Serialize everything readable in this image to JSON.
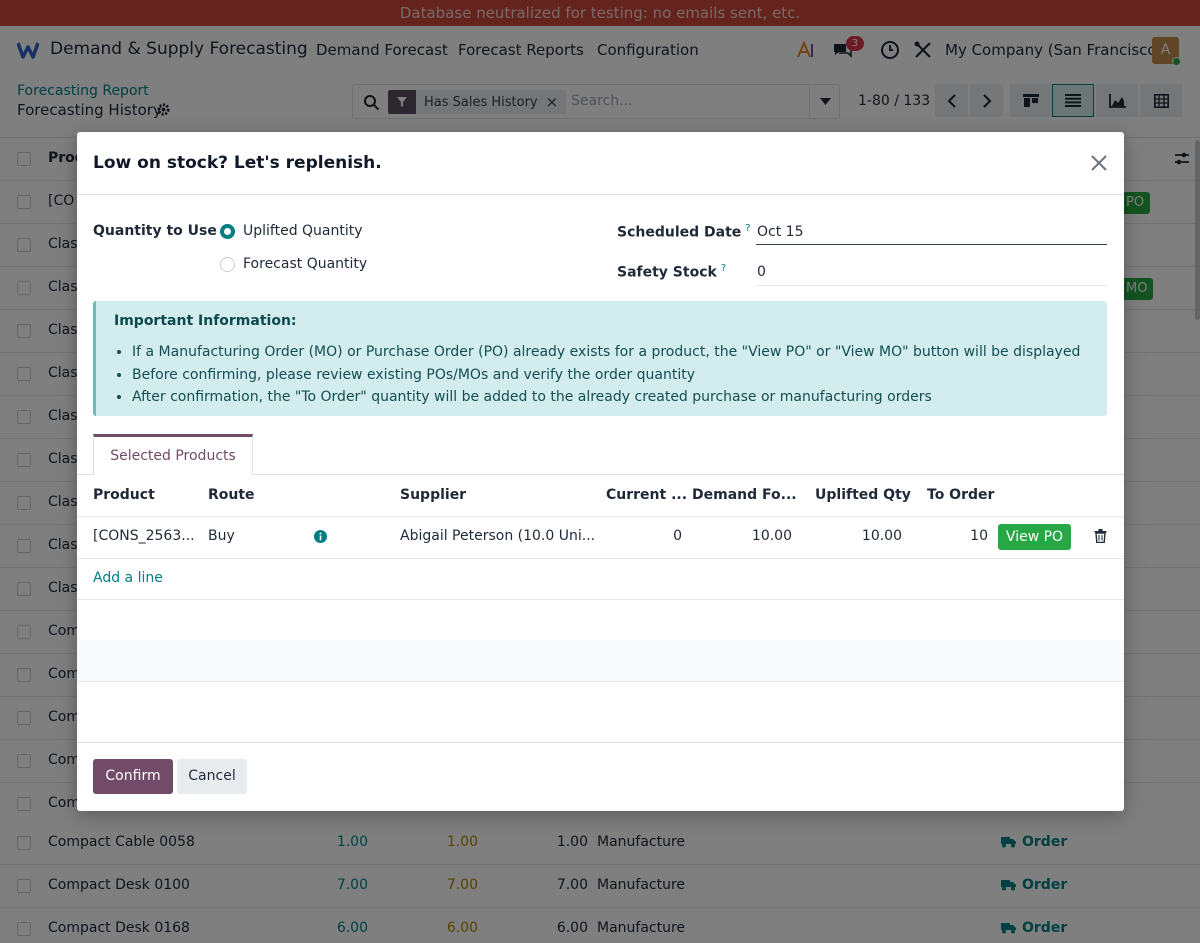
{
  "banner": {
    "text": "Database neutralized for testing: no emails sent, etc."
  },
  "navbar": {
    "app_name": "Demand & Supply Forecasting",
    "menus": [
      "Demand Forecast",
      "Forecast Reports",
      "Configuration"
    ],
    "message_count": "3",
    "company": "My Company (San Francisco)",
    "avatar_letter": "A"
  },
  "control_panel": {
    "breadcrumb_parent": "Forecasting Report",
    "breadcrumb_current": "Forecasting History",
    "search": {
      "facet": "Has Sales History",
      "placeholder": "Search..."
    },
    "pager": "1-80 / 133"
  },
  "list": {
    "header_product": "Prod",
    "rows_partial": [
      "[CO",
      "Clas",
      "Clas",
      "Clas",
      "Clas",
      "Clas",
      "Clas",
      "Clas",
      "Clas",
      "Clas",
      "Com",
      "Com",
      "Com",
      "Com",
      "Com"
    ],
    "badges": [
      {
        "row": 0,
        "text": "PO"
      },
      {
        "row": 2,
        "text": "MO"
      }
    ],
    "visible_rows": [
      {
        "name": "Compact Cable 0058",
        "v1": "1.00",
        "v2": "1.00",
        "v3": "1.00",
        "route": "Manufacture",
        "action": "Order"
      },
      {
        "name": "Compact Desk 0100",
        "v1": "7.00",
        "v2": "7.00",
        "v3": "7.00",
        "route": "Manufacture",
        "action": "Order"
      },
      {
        "name": "Compact Desk 0168",
        "v1": "6.00",
        "v2": "6.00",
        "v3": "6.00",
        "route": "Manufacture",
        "action": "Order"
      }
    ]
  },
  "modal": {
    "title": "Low on stock? Let's replenish.",
    "quantity_label": "Quantity to Use",
    "options": [
      "Uplifted Quantity",
      "Forecast Quantity"
    ],
    "selected_option": "Uplifted Quantity",
    "scheduled_date_label": "Scheduled Date",
    "scheduled_date": "Oct 15",
    "safety_stock_label": "Safety Stock",
    "safety_stock": "0",
    "help_mark": "?",
    "info_title": "Important Information:",
    "info_items": [
      "If a Manufacturing Order (MO) or Purchase Order (PO) already exists for a product, the \"View PO\" or \"View MO\" button will be displayed",
      "Before confirming, please review existing POs/MOs and verify the order quantity",
      "After confirmation, the \"To Order\" quantity will be added to the already created purchase or manufacturing orders"
    ],
    "tab": "Selected Products",
    "columns": [
      "Product",
      "Route",
      "Supplier",
      "Current ...",
      "Demand Fo...",
      "Uplifted Qty",
      "To Order"
    ],
    "rows": [
      {
        "product": "[CONS_2563...",
        "route": "Buy",
        "supplier": "Abigail Peterson (10.0 Uni...",
        "current": "0",
        "demand": "10.00",
        "uplifted": "10.00",
        "to_order": "10",
        "action": "View PO"
      }
    ],
    "add_line": "Add a line",
    "confirm": "Confirm",
    "cancel": "Cancel"
  },
  "colors": {
    "accent": "#017e84",
    "brand": "#714b67",
    "success": "#27a844",
    "banner": "#c9473b"
  }
}
